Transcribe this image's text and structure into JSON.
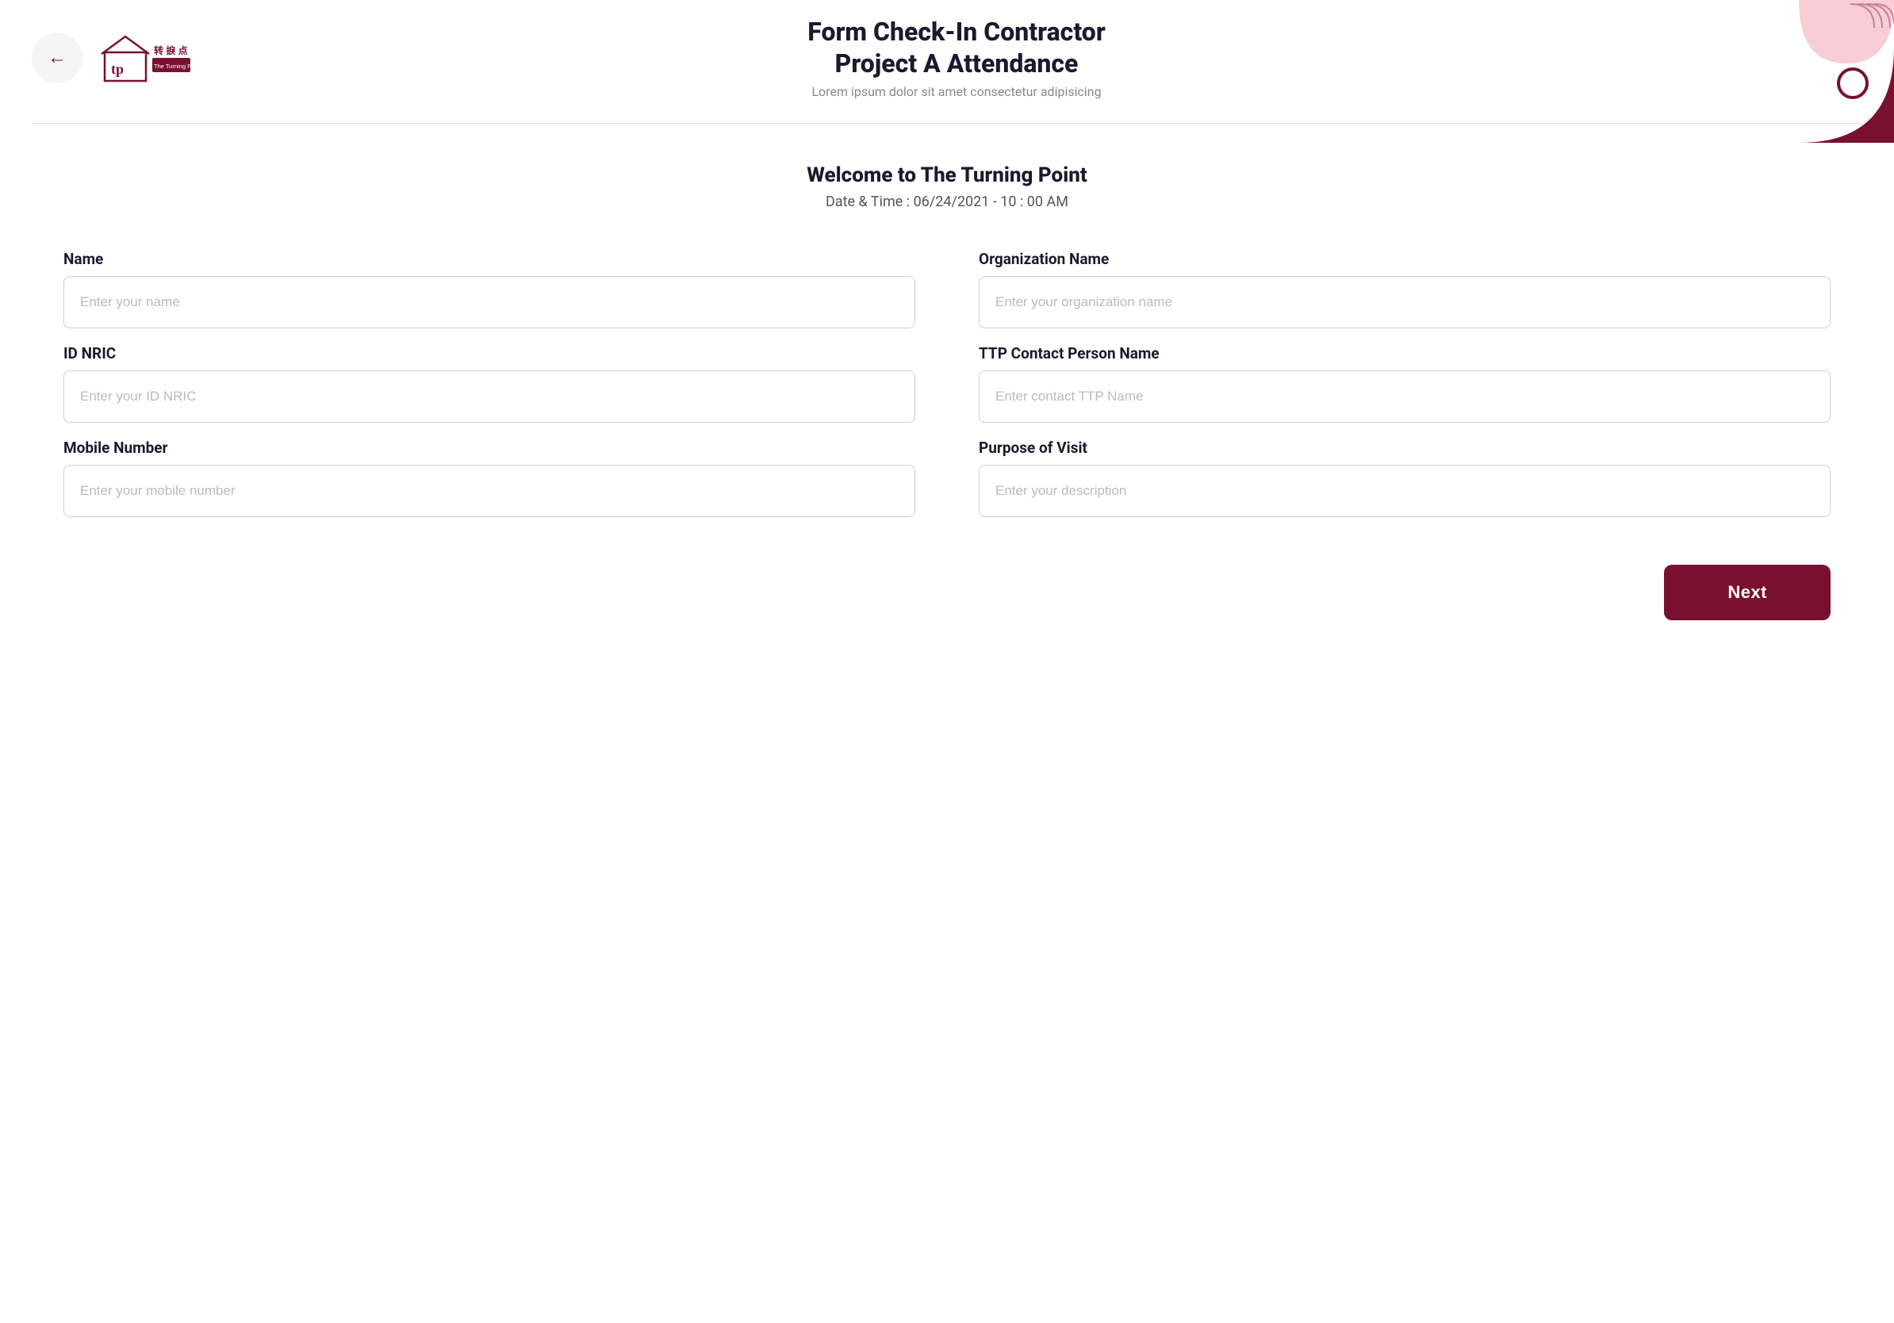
{
  "header": {
    "back_label": "←",
    "title_line1": "Form Check-In Contractor",
    "title_line2": "Project A Attendance",
    "subtitle": "Lorem ipsum dolor sit amet consectetur adipisicing",
    "logo_text": "转捩点",
    "logo_sub": "The Turning Point"
  },
  "welcome": {
    "title": "Welcome to The Turning Point",
    "datetime_label": "Date & Time :",
    "datetime_value": "06/24/2021 - 10 : 00 AM"
  },
  "form": {
    "name_label": "Name",
    "name_placeholder": "Enter your name",
    "org_label": "Organization Name",
    "org_placeholder": "Enter your organization name",
    "id_label": "ID NRIC",
    "id_placeholder": "Enter your ID NRIC",
    "ttp_label": "TTP Contact Person Name",
    "ttp_placeholder": "Enter contact TTP Name",
    "mobile_label": "Mobile Number",
    "mobile_placeholder": "Enter your mobile number",
    "purpose_label": "Purpose of Visit",
    "purpose_placeholder": "Enter your description"
  },
  "buttons": {
    "next_label": "Next"
  },
  "colors": {
    "brand": "#7a1030",
    "brand_light": "#e8a0b0",
    "deco_pink": "#f2b8c6",
    "deco_dark": "#7a1030"
  }
}
